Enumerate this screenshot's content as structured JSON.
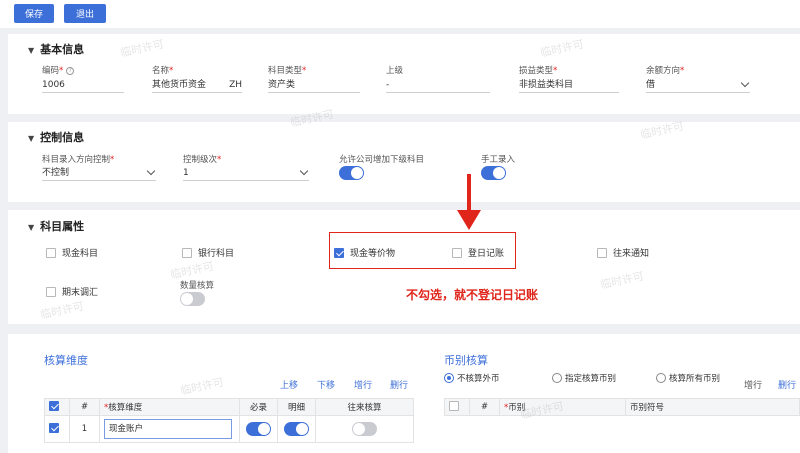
{
  "toolbar": {
    "save_label": "保存",
    "exit_label": "退出"
  },
  "watermark": "临时许可",
  "basic": {
    "title": "基本信息",
    "code": {
      "label": "编码",
      "value": "1006"
    },
    "name": {
      "label": "名称",
      "value": "其他货币资金",
      "suffix": "ZH"
    },
    "type": {
      "label": "科目类型",
      "value": "资产类"
    },
    "parent": {
      "label": "上级",
      "value": "-"
    },
    "pl": {
      "label": "损益类型",
      "value": "非损益类科目"
    },
    "balance": {
      "label": "余额方向",
      "value": "借"
    }
  },
  "control": {
    "title": "控制信息",
    "entry": {
      "label": "科目录入方向控制",
      "value": "不控制"
    },
    "level": {
      "label": "控制级次",
      "value": "1"
    },
    "allow_sub": {
      "label": "允许公司增加下级科目",
      "on": true
    },
    "manual": {
      "label": "手工录入",
      "on": true
    }
  },
  "attrs": {
    "title": "科目属性",
    "cash": "现金科目",
    "bank": "银行科目",
    "cash_eq": "现金等价物",
    "journal": "登日记账",
    "notice": "往来通知",
    "period_adjust": "期末调汇",
    "qty": "数量核算"
  },
  "annotation": "不勾选，就不登记日记账",
  "dim": {
    "title": "核算维度",
    "actions": [
      "上移",
      "下移",
      "增行",
      "删行"
    ],
    "headers": [
      "#",
      "核算维度",
      "必录",
      "明细",
      "往来核算"
    ],
    "rows": [
      {
        "index": "1",
        "name": "现金账户"
      }
    ]
  },
  "currency": {
    "title": "币别核算",
    "radios": [
      "不核算外币",
      "指定核算币别",
      "核算所有币别"
    ],
    "actions": [
      "增行",
      "删行"
    ],
    "headers": [
      "#",
      "币别",
      "币别符号"
    ]
  },
  "colors": {
    "primary": "#3d6fd9",
    "annotation": "#e0251b"
  }
}
